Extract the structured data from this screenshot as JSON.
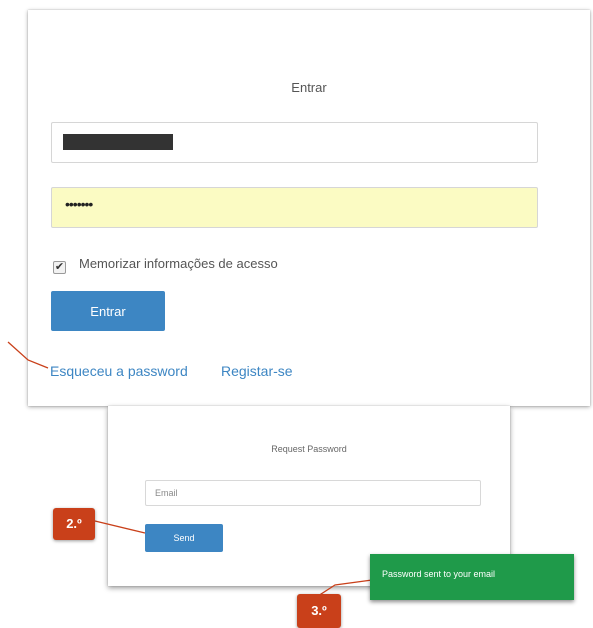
{
  "login": {
    "title": "Entrar",
    "username_value": "",
    "password_value": "•••••••",
    "remember_label": "Memorizar informações de acesso",
    "remember_checked": true,
    "submit_label": "Entrar",
    "forgot_link": "Esqueceu a password",
    "register_link": "Registar-se"
  },
  "request_password": {
    "title": "Request Password",
    "email_placeholder": "Email",
    "send_label": "Send"
  },
  "annotations": {
    "step2_label": "2.º",
    "step3_label": "3.º"
  },
  "toast": {
    "message": "Password sent to your email"
  },
  "colors": {
    "accent_blue": "#3d86c3",
    "autofill_yellow": "#fbfbc3",
    "badge_red": "#c9401a",
    "toast_green": "#1f9a4a"
  }
}
